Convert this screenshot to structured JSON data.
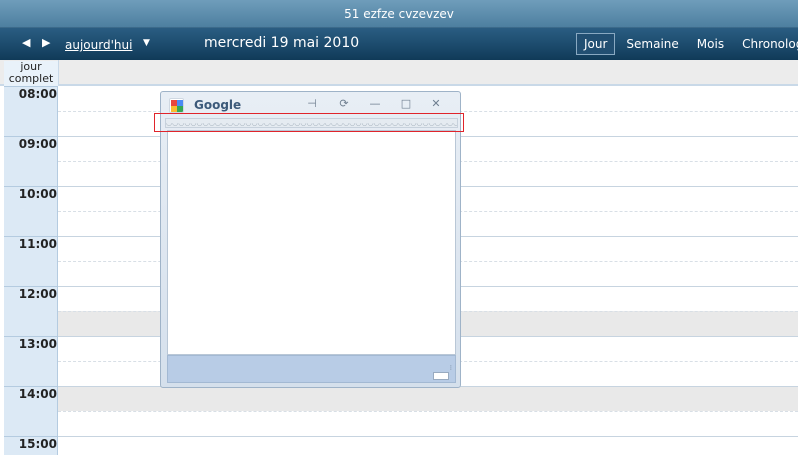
{
  "window": {
    "title": "51 ezfze cvzevzev"
  },
  "toolbar": {
    "prev_next": "◀ ▶",
    "today_label": "aujourd'hui",
    "today_caret": "▼",
    "date_title": "mercredi 19 mai 2010",
    "views": [
      {
        "label": "Jour",
        "active": true
      },
      {
        "label": "Semaine",
        "active": false
      },
      {
        "label": "Mois",
        "active": false
      },
      {
        "label": "Chronologie",
        "active": false
      }
    ]
  },
  "allday": {
    "label_line1": "jour",
    "label_line2": "complet"
  },
  "hours": [
    "08:00",
    "09:00",
    "10:00",
    "11:00",
    "12:00",
    "13:00",
    "14:00",
    "15:00"
  ],
  "gadget": {
    "title": "Google",
    "logo_icon": "google-gadget-icon",
    "buttons": [
      {
        "name": "pin-icon",
        "glyph": "⊣"
      },
      {
        "name": "refresh-icon",
        "glyph": "⟳"
      },
      {
        "name": "minimize-icon",
        "glyph": "—"
      },
      {
        "name": "maximize-icon",
        "glyph": "□"
      },
      {
        "name": "close-icon",
        "glyph": "✕"
      }
    ]
  },
  "colors": {
    "header_blue": "#1d4c6e",
    "time_column": "#dce9f5",
    "highlight": "#e0242b",
    "gadget_footer": "#b8cce6"
  }
}
